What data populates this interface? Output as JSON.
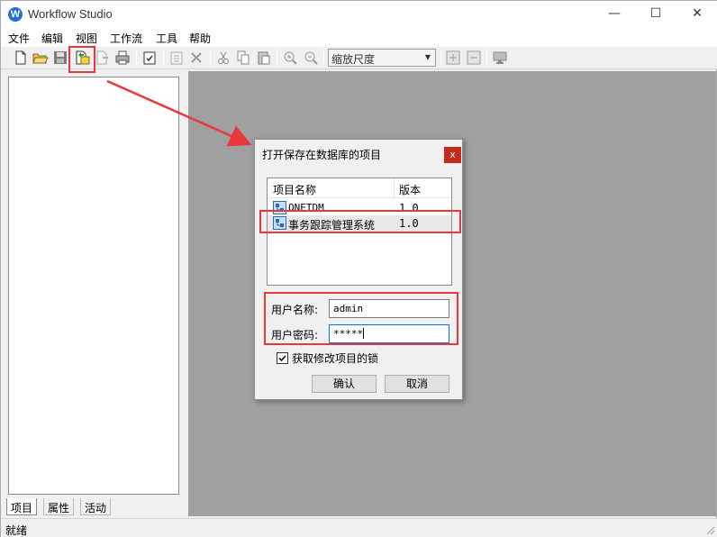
{
  "app": {
    "title": "Workflow Studio",
    "icon": "workflow-app-icon"
  },
  "window_controls": {
    "minimize": "—",
    "maximize": "☐",
    "close": "✕"
  },
  "menu": [
    "文件",
    "编辑",
    "视图",
    "工作流",
    "工具",
    "帮助"
  ],
  "toolbar": {
    "zoom_label": "缩放尺度",
    "buttons": [
      "new-file-icon",
      "open-folder-icon",
      "save-icon",
      "open-from-database-icon",
      "export-icon",
      "print-icon",
      "check-icon",
      "properties-icon",
      "delete-icon",
      "cut-icon",
      "copy-icon",
      "paste-icon",
      "zoom-in-icon",
      "zoom-out-icon",
      "expand-icon",
      "collapse-icon",
      "monitor-icon"
    ]
  },
  "left_panel": {
    "tabs": [
      "项目",
      "属性",
      "活动"
    ],
    "active_tab": "项目"
  },
  "status": {
    "text": "就绪"
  },
  "dialog": {
    "title": "打开保存在数据库的项目",
    "close": "x",
    "columns": {
      "name": "项目名称",
      "version": "版本"
    },
    "rows": [
      {
        "name": "ONETDM",
        "version": "1.0"
      },
      {
        "name": "事务跟踪管理系统",
        "version": "1.0"
      }
    ],
    "username_label": "用户名称:",
    "username_value": "admin",
    "password_label": "用户密码:",
    "password_value": "*****",
    "lock_checkbox_label": "获取修改项目的锁",
    "lock_checked": true,
    "ok_label": "确认",
    "cancel_label": "取消"
  },
  "annotation_color": "#e8383d"
}
